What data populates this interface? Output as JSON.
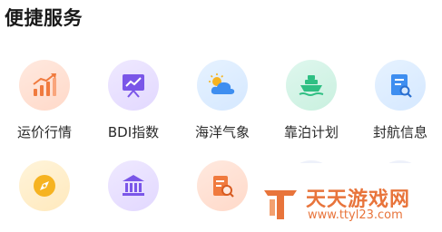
{
  "section": {
    "title": "便捷服务"
  },
  "services_row1": [
    {
      "label": "运价行情",
      "icon": "freight-rate-chart-icon"
    },
    {
      "label": "BDI指数",
      "icon": "bdi-index-board-icon"
    },
    {
      "label": "海洋气象",
      "icon": "weather-icon"
    },
    {
      "label": "靠泊计划",
      "icon": "ship-berthing-icon"
    },
    {
      "label": "封航信息",
      "icon": "document-search-icon"
    }
  ],
  "services_row2": [
    {
      "icon": "compass-icon"
    },
    {
      "icon": "bank-icon"
    },
    {
      "icon": "report-search-icon"
    }
  ],
  "watermark": {
    "name": "天天游戏网",
    "url": "www.ttyl23.com"
  },
  "colors": {
    "orange": "#f07a3e",
    "purple": "#7a56e8",
    "blue": "#3e8ef0",
    "green": "#2fbf83",
    "yellow": "#f6b321"
  }
}
